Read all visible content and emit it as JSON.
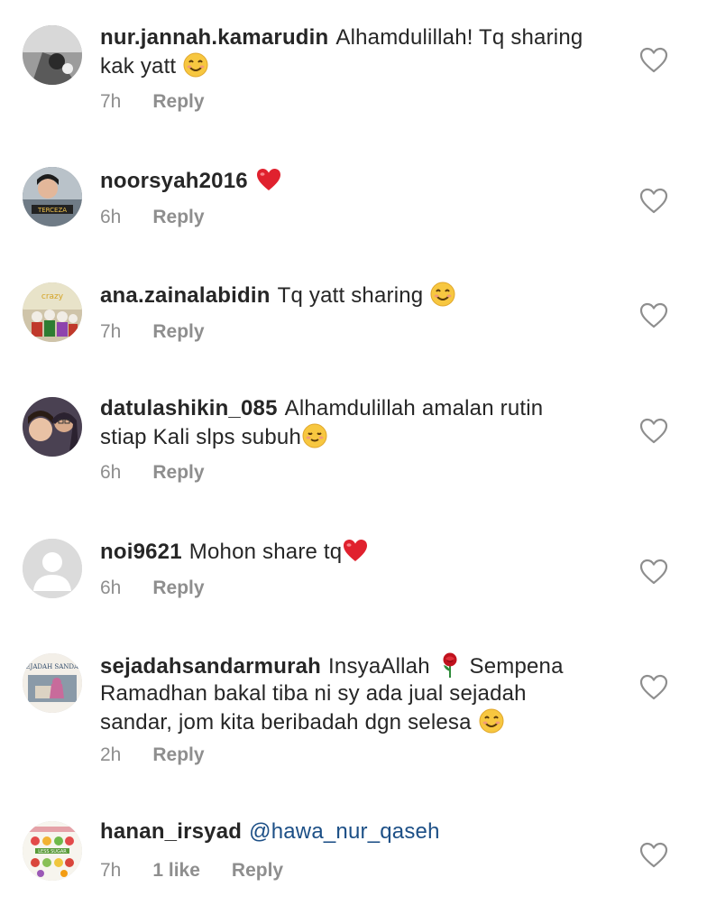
{
  "comments": [
    {
      "username": "nur.jannah.kamarudin",
      "text": "Alhamdulillah! Tq sharing kak yatt",
      "emoji": "smile-emoji",
      "time": "7h",
      "reply": "Reply"
    },
    {
      "username": "noorsyah2016",
      "text": "",
      "emoji": "heart-emoji",
      "time": "6h",
      "reply": "Reply"
    },
    {
      "username": "ana.zainalabidin",
      "text": "Tq yatt sharing",
      "emoji": "smile-emoji",
      "time": "7h",
      "reply": "Reply"
    },
    {
      "username": "datulashikin_085",
      "line1": "Alhamdulillah amalan rutin",
      "line2": "stiap Kali slps subuh",
      "emoji": "relieved-emoji",
      "time": "6h",
      "reply": "Reply"
    },
    {
      "username": "noi9621",
      "text": "Mohon share tq",
      "emoji": "heart-emoji",
      "time": "6h",
      "reply": "Reply"
    },
    {
      "username": "sejadahsandarmurah",
      "text_a": "InsyaAllah",
      "emoji_a": "rose-emoji",
      "text_b": "Sempena",
      "line2": "Ramadhan bakal tiba ni sy ada jual sejadah",
      "line3": "sandar, jom kita beribadah dgn selesa",
      "emoji": "smile-emoji",
      "time": "2h",
      "reply": "Reply"
    },
    {
      "username": "hanan_irsyad",
      "mention": "@hawa_nur_qaseh",
      "time": "7h",
      "likes": "1 like",
      "reply": "Reply"
    }
  ],
  "colors": {
    "text": "#262626",
    "meta": "#8e8e8e",
    "mention": "#1c4f86",
    "heart_outline": "#8e8e8e",
    "heart_emoji": "#e0212e"
  },
  "icons": {
    "like_button": "heart-outline-icon",
    "avatar_placeholder": "default-avatar-icon"
  }
}
